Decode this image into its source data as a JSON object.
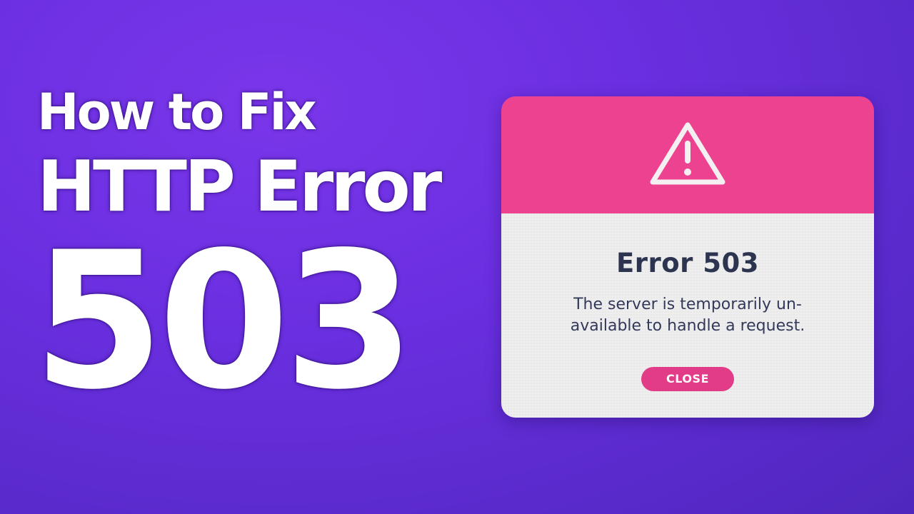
{
  "headline": {
    "line1": "How to Fix",
    "line2": "HTTP Error",
    "line3": "503"
  },
  "dialog": {
    "icon": "warning-triangle-icon",
    "title": "Error 503",
    "message": "The server is temporarily un-available to handle a request.",
    "close_label": "CLOSE"
  },
  "colors": {
    "background": "#6a2fe0",
    "dialog_header": "#ec4290",
    "dialog_body": "#eeeeee",
    "text_dark": "#2d3450",
    "button": "#e23b87"
  }
}
